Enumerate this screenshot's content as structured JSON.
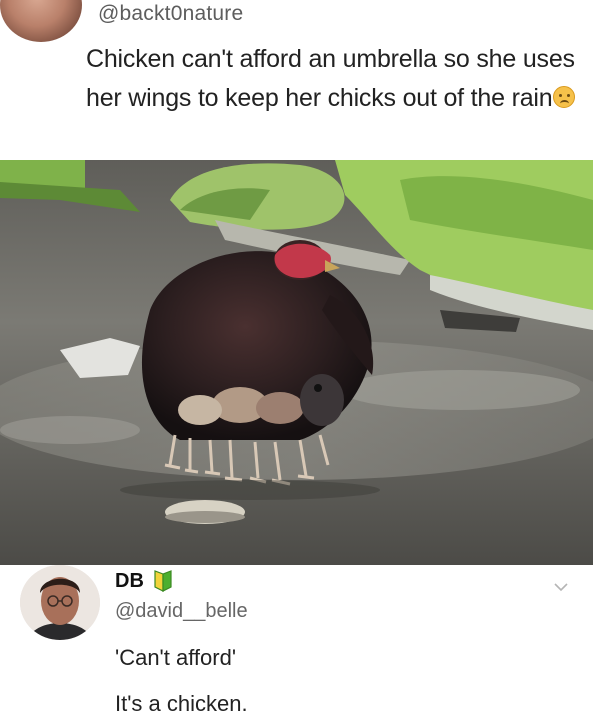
{
  "post": {
    "handle": "@backt0nature",
    "text": "Chicken can't afford an umbrella so she uses her wings to keep her chicks out of the rain",
    "emoji_icon": "sad-face-emoji-icon"
  },
  "photo": {
    "icon": "hen-with-chicks-photo"
  },
  "reply": {
    "name": "DB",
    "badge_icon": "beginner-badge-icon",
    "handle": "@david__belle",
    "line1": "'Can't afford'",
    "line2": "It's a chicken.",
    "menu_icon": "chevron-down-icon"
  },
  "colors": {
    "badge_green": "#4caf2f",
    "badge_yellow": "#f2d33a",
    "photo_ground": "#6d6b66"
  }
}
